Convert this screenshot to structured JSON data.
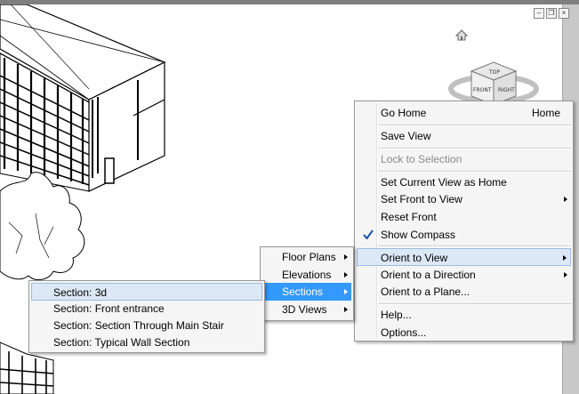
{
  "context_menu": {
    "items": [
      {
        "label": "Go Home",
        "shortcut": "Home"
      },
      {
        "label": "Save View"
      },
      {
        "label": "Lock to Selection",
        "disabled": true
      },
      {
        "label": "Set Current View as Home"
      },
      {
        "label": "Set Front to View",
        "submenu": true
      },
      {
        "label": "Reset Front"
      },
      {
        "label": "Show Compass",
        "checked": true
      },
      {
        "label": "Orient to View",
        "submenu": true,
        "state": "hover"
      },
      {
        "label": "Orient to a Direction",
        "submenu": true
      },
      {
        "label": "Orient to a Plane..."
      },
      {
        "label": "Help..."
      },
      {
        "label": "Options..."
      }
    ]
  },
  "orient_submenu": {
    "items": [
      {
        "label": "Floor Plans",
        "submenu": true
      },
      {
        "label": "Elevations",
        "submenu": true
      },
      {
        "label": "Sections",
        "submenu": true,
        "state": "selected"
      },
      {
        "label": "3D Views",
        "submenu": true
      }
    ]
  },
  "sections_submenu": {
    "items": [
      {
        "label": "Section: 3d",
        "state": "hover"
      },
      {
        "label": "Section: Front entrance"
      },
      {
        "label": "Section: Section Through Main Stair"
      },
      {
        "label": "Section: Typical Wall Section"
      }
    ]
  },
  "viewcube": {
    "top": "TOP",
    "front": "FRONT",
    "right": "RIGHT"
  },
  "colors": {
    "highlight": "#3399ff",
    "hover": "#dce8f6",
    "menu_bg": "#f5f5f5"
  }
}
